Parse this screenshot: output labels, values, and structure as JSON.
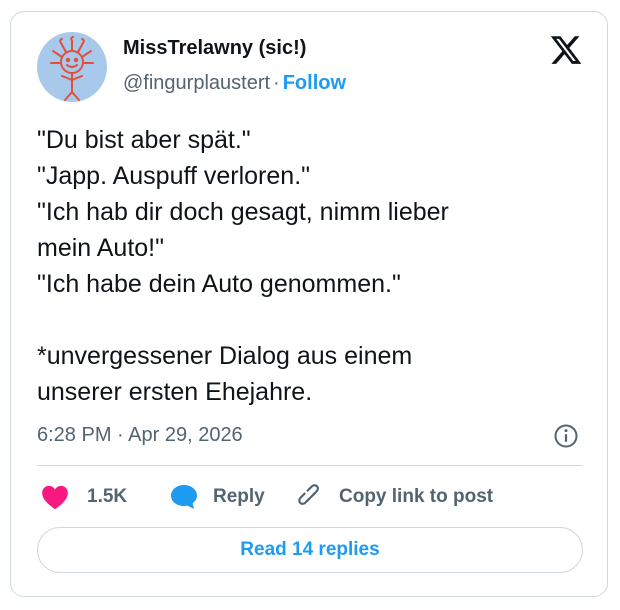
{
  "colors": {
    "accent": "#1d9bf0",
    "like": "#f91880",
    "text": "#0f1419",
    "muted": "#536471",
    "border": "#cfd9de",
    "avatar_bg": "#a9c9ec",
    "avatar_drawing": "#e0503a"
  },
  "author": {
    "display_name": "MissTrelawny (sic!)",
    "handle": "@fingurplaustert",
    "separator": "·",
    "follow_label": "Follow",
    "avatar_icon": "sun-face-drawing"
  },
  "platform_icon": "x-logo-icon",
  "tweet": {
    "text": "\"Du bist aber spät.\"\n\"Japp. Auspuff verloren.\"\n\"Ich hab dir doch gesagt, nimm lieber\nmein Auto!\"\n\"Ich habe dein Auto genommen.\"\n\n*unvergessener Dialog aus einem\nunserer ersten Ehejahre.",
    "timestamp": "6:28 PM · Apr 29, 2026",
    "info_icon": "info-icon"
  },
  "actions": {
    "like_count": "1.5K",
    "like_icon": "heart-icon",
    "reply_label": "Reply",
    "reply_icon": "speech-bubble-icon",
    "copy_label": "Copy link to post",
    "copy_icon": "link-icon"
  },
  "read_replies_label": "Read 14 replies"
}
